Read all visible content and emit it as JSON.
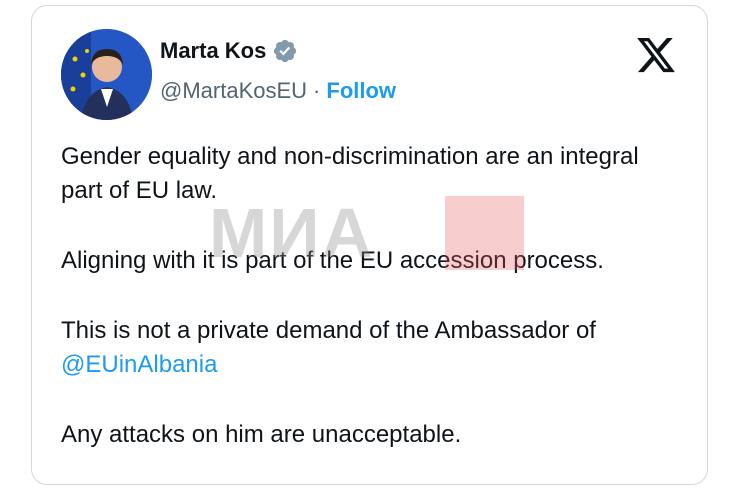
{
  "author": {
    "name": "Marta Kos",
    "handle": "@MartaKosEU",
    "separator": "·",
    "follow_label": "Follow",
    "verified_icon": "verified-badge-icon"
  },
  "platform_icon": "x-logo-icon",
  "tweet": {
    "paragraphs": [
      "Gender equality and non-discrimination are an integral part of EU law.",
      "Aligning with it is part of the EU accession process.",
      "This is not a private demand of the Ambassador of",
      "Any attacks on him are unacceptable."
    ],
    "mention": "@EUinAlbania"
  },
  "watermark": {
    "text": "МИА"
  },
  "colors": {
    "text": "#0f1419",
    "secondary": "#536471",
    "link": "#1d9bf0",
    "verified": "#829aab"
  }
}
